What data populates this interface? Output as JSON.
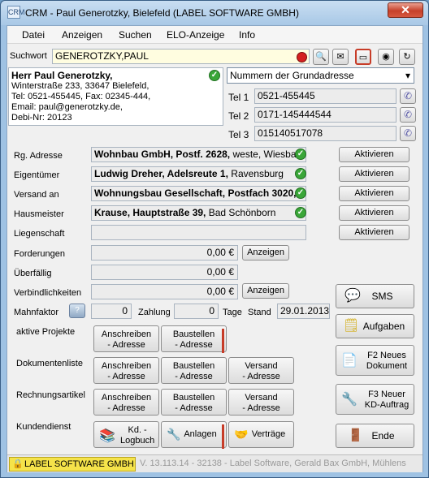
{
  "window": {
    "title": "CRM - Paul Generotzky, Bielefeld (LABEL SOFTWARE GMBH)",
    "close": "✕",
    "app_icon": "CRM"
  },
  "menu": [
    "Datei",
    "Anzeigen",
    "Suchen",
    "ELO-Anzeige",
    "Info"
  ],
  "search": {
    "label": "Suchwort",
    "value": "GENEROTZKY,PAUL"
  },
  "address": {
    "name": "Herr Paul Generotzky,",
    "street": "Winterstraße 233, 33647 Bielefeld,",
    "phone_fax": "Tel: 0521-455445, Fax: 02345-444,",
    "email": "Email: paul@generotzky.de,",
    "debi": "Debi-Nr: 20123"
  },
  "address_select": {
    "value": "Nummern der Grundadresse"
  },
  "phones": [
    {
      "label": "Tel 1",
      "value": "0521-455445"
    },
    {
      "label": "Tel 2",
      "value": "0171-145444544"
    },
    {
      "label": "Tel 3",
      "value": "015140517078"
    }
  ],
  "roles": [
    {
      "label": "Rg. Adresse",
      "bold": "Wohnbau GmbH, Postf. 2628,",
      "rest": " weste, Wiesbad",
      "button": "Aktivieren"
    },
    {
      "label": "Eigentümer",
      "bold": "Ludwig Dreher, Adelsreute 1,",
      "rest": " Ravensburg",
      "button": "Aktivieren"
    },
    {
      "label": "Versand an",
      "bold": "Wohnungsbau Gesellschaft, Postfach 3020,",
      "rest": "",
      "button": "Aktivieren"
    },
    {
      "label": "Hausmeister",
      "bold": "Krause, Hauptstraße 39,",
      "rest": " Bad Schönborn",
      "button": "Aktivieren"
    },
    {
      "label": "Liegenschaft",
      "bold": "",
      "rest": "",
      "button": "Aktivieren"
    }
  ],
  "finance": [
    {
      "label": "Forderungen",
      "value": "0,00 €",
      "button": "Anzeigen"
    },
    {
      "label": "Überfällig",
      "value": "0,00 €",
      "button": ""
    },
    {
      "label": "Verbindlichkeiten",
      "value": "0,00 €",
      "button": "Anzeigen"
    }
  ],
  "mahn": {
    "label": "Mahnfaktor",
    "value": "0",
    "zahlung_label": "Zahlung",
    "zahlung_value": "0",
    "tage_label": "Tage",
    "stand_label": "Stand",
    "stand_value": "29.01.2013"
  },
  "sections": {
    "projekte": {
      "label": "aktive Projekte",
      "b1": "Anschreiben\n- Adresse",
      "b2": "Baustellen\n- Adresse"
    },
    "dokumente": {
      "label": "Dokumentenliste",
      "b1": "Anschreiben\n- Adresse",
      "b2": "Baustellen\n- Adresse",
      "b3": "Versand\n- Adresse"
    },
    "rechnung": {
      "label": "Rechnungsartikel",
      "b1": "Anschreiben\n- Adresse",
      "b2": "Baustellen\n- Adresse",
      "b3": "Versand\n- Adresse"
    },
    "kunden": {
      "label": "Kundendienst",
      "b1": "Kd. -\nLogbuch",
      "b2": "Anlagen",
      "b3": "Verträge"
    }
  },
  "right_buttons": {
    "sms": "SMS",
    "aufgaben": "Aufgaben",
    "f2": "F2 Neues\nDokument",
    "f3": "F3 Neuer\nKD-Auftrag",
    "ende": "Ende"
  },
  "status": {
    "company": "LABEL SOFTWARE GMBH",
    "info": "V. 13.113.14 - 32138 - Label Software, Gerald Bax GmbH, Mühlens"
  },
  "colors": {
    "accent_red": "#c73c28",
    "ok_green": "#3aa638",
    "status_yellow": "#f5e34a"
  }
}
